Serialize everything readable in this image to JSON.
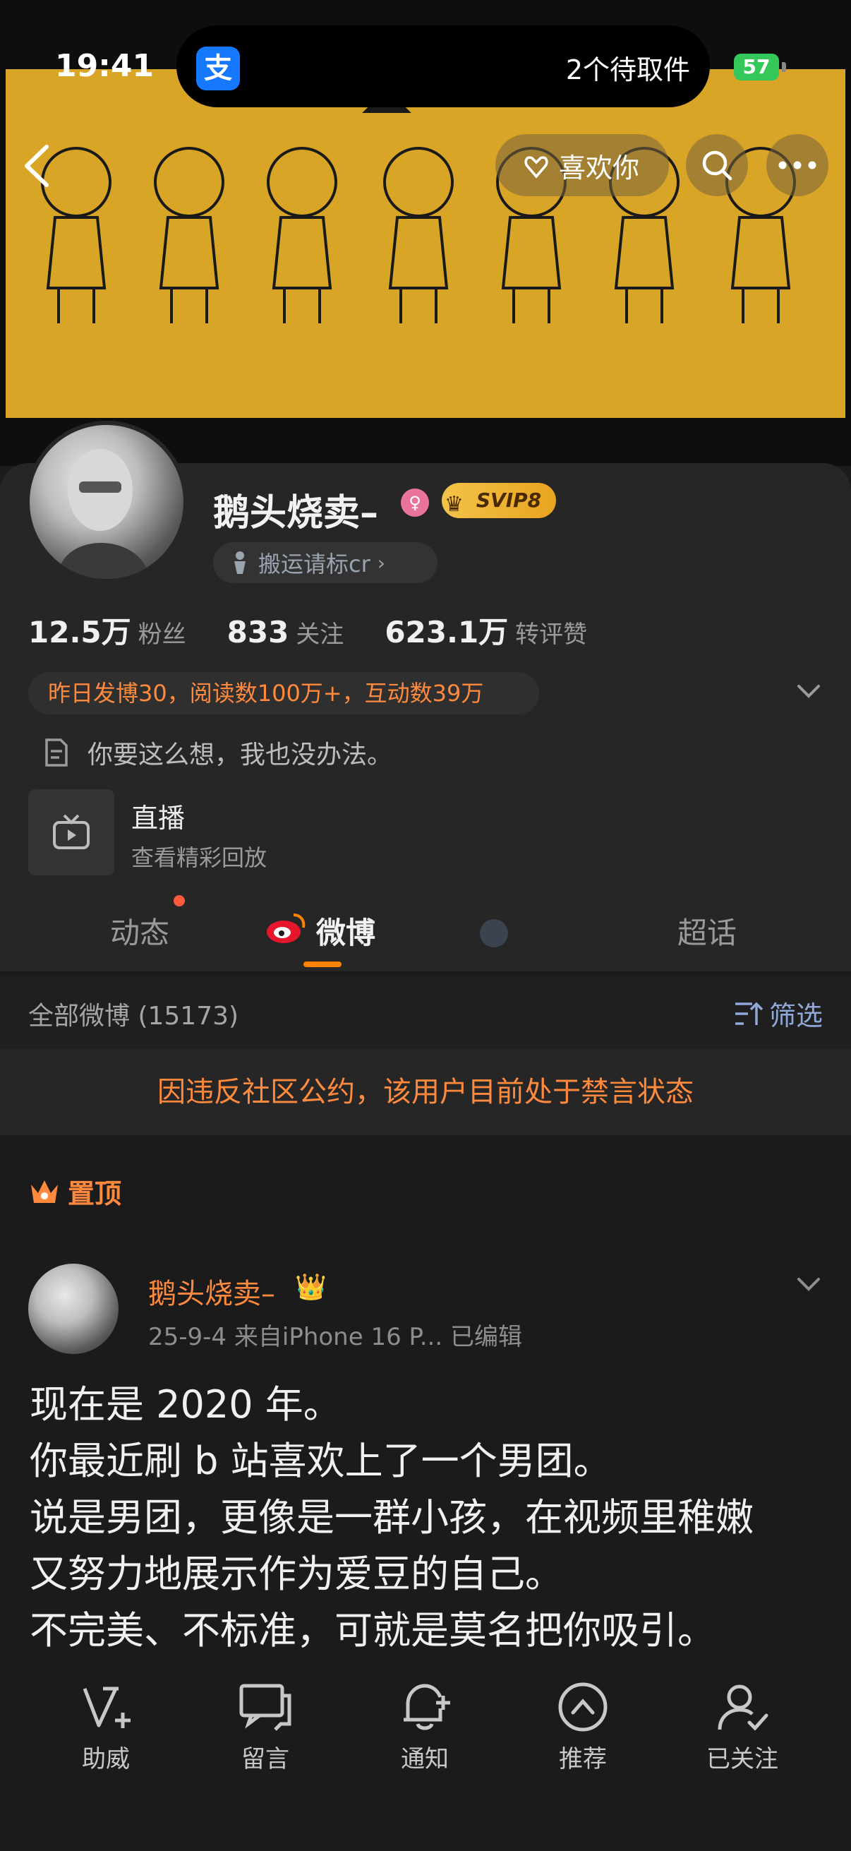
{
  "status_bar": {
    "time": "19:41",
    "island_app": "支",
    "island_text": "2个待取件",
    "battery": "57"
  },
  "header": {
    "like_label": "喜欢你"
  },
  "profile": {
    "name": "鹅头烧卖–",
    "vip": "SVIP8",
    "tag": "搬运请标cr",
    "stats": [
      {
        "value": "12.5万",
        "label": "粉丝"
      },
      {
        "value": "833",
        "label": "关注"
      },
      {
        "value": "623.1万",
        "label": "转评赞"
      }
    ],
    "announcement": "昨日发博30，阅读数100万+，互动数39万",
    "bio": "你要这么想，我也没办法。",
    "live_title": "直播",
    "live_sub": "查看精彩回放"
  },
  "tabs": [
    "动态",
    "微博",
    "超话"
  ],
  "filter": {
    "count_label": "全部微博 (15173)",
    "filter_label": "筛选"
  },
  "ban_notice": "因违反社区公约，该用户目前处于禁言状态",
  "pinned_label": "置顶",
  "post": {
    "author": "鹅头烧卖–",
    "meta": "25-9-4  来自iPhone 16 P...  已编辑",
    "lines": [
      "现在是 2020 年。",
      "你最近刷 b 站喜欢上了一个男团。",
      "说是男团，更像是一群小孩，在视频里稚嫩",
      "又努力地展示作为爱豆的自己。",
      "不完美、不标准，可就是莫名把你吸引。"
    ]
  },
  "bottom_nav": [
    "助威",
    "留言",
    "通知",
    "推荐",
    "已关注"
  ],
  "colors": {
    "accent": "#ff8a3d",
    "banner": "#d9a526",
    "tab_indicator": "#ff8200"
  }
}
